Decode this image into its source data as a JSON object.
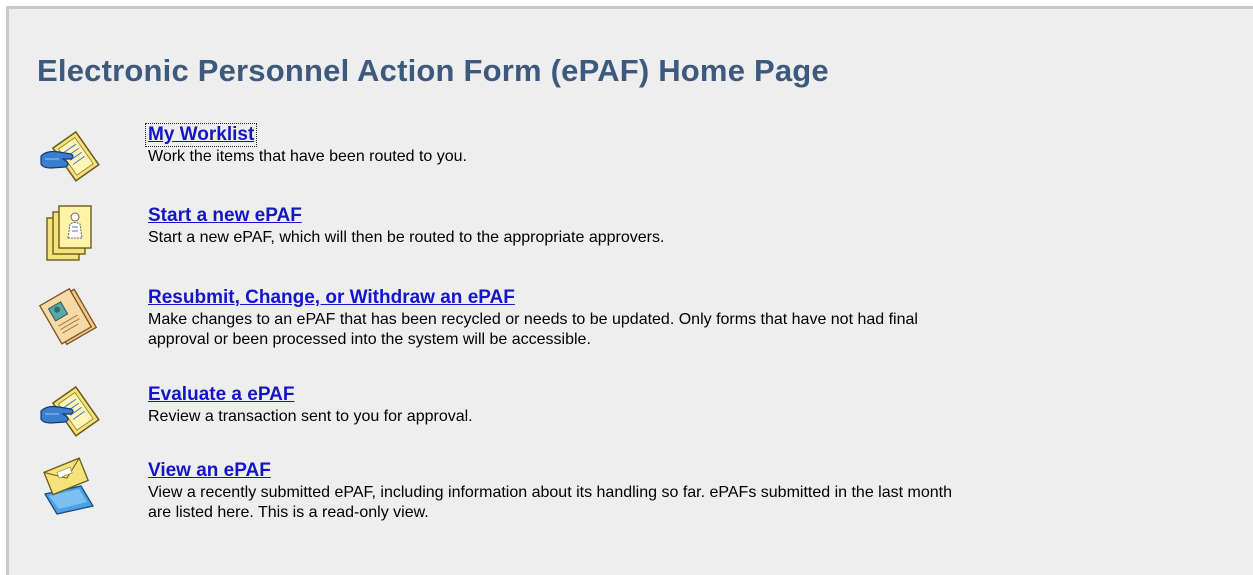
{
  "page": {
    "title": "Electronic Personnel Action Form (ePAF) Home Page"
  },
  "items": [
    {
      "icon": "hand-with-paper-icon",
      "link": "My Worklist",
      "description": "Work the items that have been routed to you."
    },
    {
      "icon": "stacked-forms-icon",
      "link": "Start a new ePAF",
      "description": "Start a new ePAF, which will then be routed to the appropriate approvers."
    },
    {
      "icon": "documents-with-photo-icon",
      "link": "Resubmit, Change, or Withdraw an ePAF",
      "description": "Make changes to an ePAF that has been recycled or needs to be updated. Only forms that have not had final approval or been processed into the system will be accessible."
    },
    {
      "icon": "hand-with-paper-icon",
      "link": "Evaluate a ePAF",
      "description": "Review a transaction sent to you for approval."
    },
    {
      "icon": "envelope-on-folder-icon",
      "link": "View an ePAF",
      "description": "View a recently submitted ePAF, including information about its handling so far. ePAFs submitted in the last month are listed here. This is a read-only view."
    }
  ],
  "colors": {
    "title": "#3d5a7e",
    "link": "#1414c8",
    "panel_background": "#eeeeee"
  }
}
